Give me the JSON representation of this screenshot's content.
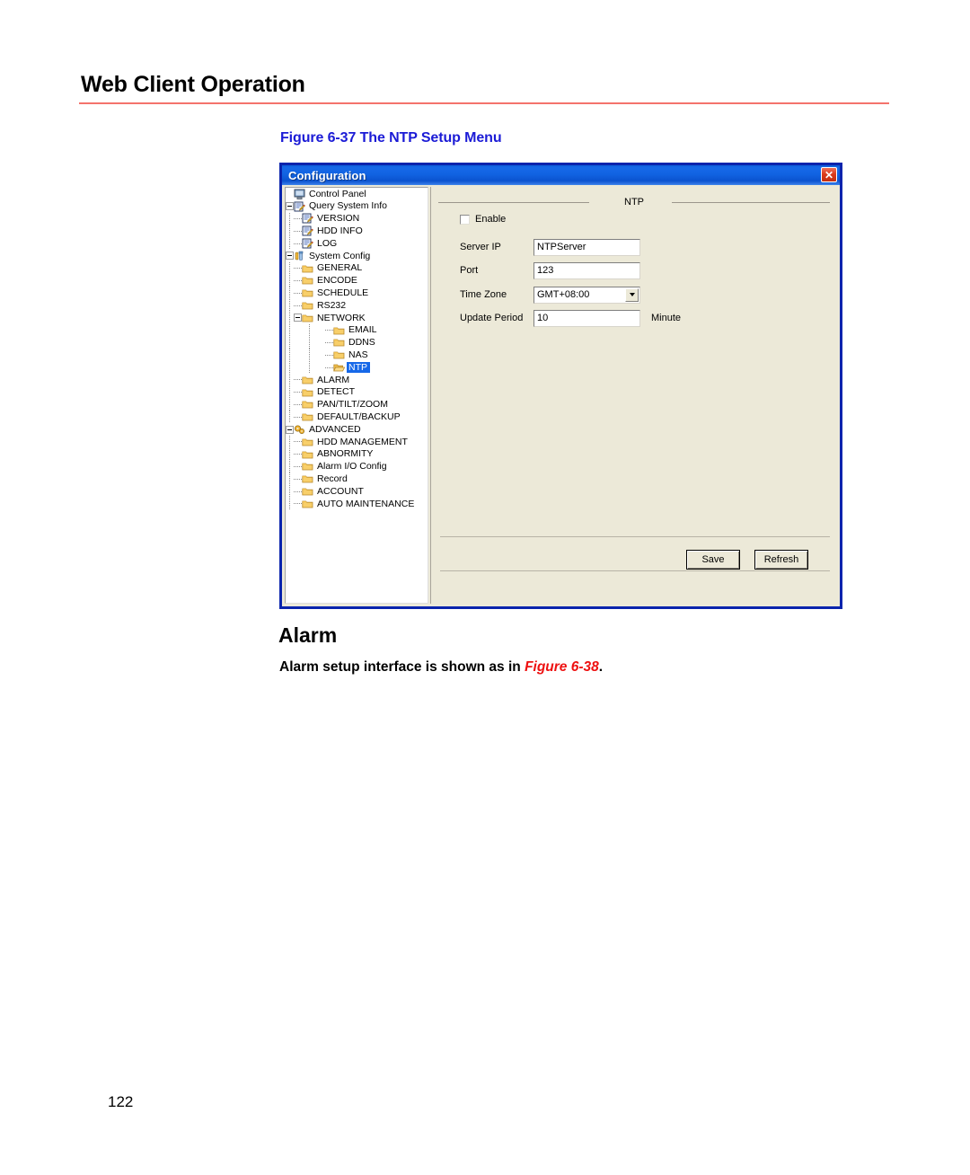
{
  "page": {
    "header_title": "Web Client Operation",
    "figure_caption": "Figure 6-37 The NTP Setup Menu",
    "section_heading": "Alarm",
    "body_text_before": "Alarm setup interface is shown as in ",
    "body_figref": "Figure 6-38",
    "body_text_after": ".",
    "page_number": "122",
    "rule_color": "#f4736c",
    "caption_color": "#1b1bd6",
    "figref_color": "#ee1111"
  },
  "dialog": {
    "title": "Configuration",
    "close_glyph": "✕",
    "titlebar_color": "#1163e2",
    "border_color": "#0a24ad",
    "face_color": "#ece9d8"
  },
  "tree": {
    "items": [
      {
        "label": "Control Panel",
        "depth": 0,
        "icon": "monitor-icon",
        "expander": "none",
        "selected": false
      },
      {
        "label": "Query System Info",
        "depth": 0,
        "icon": "notepad-icon",
        "expander": "expanded",
        "selected": false
      },
      {
        "label": "VERSION",
        "depth": 1,
        "icon": "notepad-icon",
        "expander": "leaf",
        "selected": false
      },
      {
        "label": "HDD INFO",
        "depth": 1,
        "icon": "notepad-icon",
        "expander": "leaf",
        "selected": false
      },
      {
        "label": "LOG",
        "depth": 1,
        "icon": "notepad-icon",
        "expander": "leaf",
        "selected": false
      },
      {
        "label": "System Config",
        "depth": 0,
        "icon": "tools-icon",
        "expander": "expanded",
        "selected": false
      },
      {
        "label": "GENERAL",
        "depth": 1,
        "icon": "folder-icon",
        "expander": "leaf",
        "selected": false
      },
      {
        "label": "ENCODE",
        "depth": 1,
        "icon": "folder-icon",
        "expander": "leaf",
        "selected": false
      },
      {
        "label": "SCHEDULE",
        "depth": 1,
        "icon": "folder-icon",
        "expander": "leaf",
        "selected": false
      },
      {
        "label": "RS232",
        "depth": 1,
        "icon": "folder-icon",
        "expander": "leaf",
        "selected": false
      },
      {
        "label": "NETWORK",
        "depth": 1,
        "icon": "folder-icon",
        "expander": "expanded",
        "selected": false
      },
      {
        "label": "EMAIL",
        "depth": 2,
        "icon": "folder-icon",
        "expander": "leaf",
        "selected": false
      },
      {
        "label": "DDNS",
        "depth": 2,
        "icon": "folder-icon",
        "expander": "leaf",
        "selected": false
      },
      {
        "label": "NAS",
        "depth": 2,
        "icon": "folder-icon",
        "expander": "leaf",
        "selected": false
      },
      {
        "label": "NTP",
        "depth": 2,
        "icon": "folder-open-icon",
        "expander": "leaf",
        "selected": true
      },
      {
        "label": "ALARM",
        "depth": 1,
        "icon": "folder-icon",
        "expander": "leaf",
        "selected": false
      },
      {
        "label": "DETECT",
        "depth": 1,
        "icon": "folder-icon",
        "expander": "leaf",
        "selected": false
      },
      {
        "label": "PAN/TILT/ZOOM",
        "depth": 1,
        "icon": "folder-icon",
        "expander": "leaf",
        "selected": false
      },
      {
        "label": "DEFAULT/BACKUP",
        "depth": 1,
        "icon": "folder-icon",
        "expander": "leaf",
        "selected": false
      },
      {
        "label": "ADVANCED",
        "depth": 0,
        "icon": "gears-icon",
        "expander": "expanded",
        "selected": false
      },
      {
        "label": "HDD MANAGEMENT",
        "depth": 1,
        "icon": "folder-icon",
        "expander": "leaf",
        "selected": false
      },
      {
        "label": "ABNORMITY",
        "depth": 1,
        "icon": "folder-icon",
        "expander": "leaf",
        "selected": false
      },
      {
        "label": "Alarm I/O Config",
        "depth": 1,
        "icon": "folder-icon",
        "expander": "leaf",
        "selected": false
      },
      {
        "label": "Record",
        "depth": 1,
        "icon": "folder-icon",
        "expander": "leaf",
        "selected": false
      },
      {
        "label": "ACCOUNT",
        "depth": 1,
        "icon": "folder-icon",
        "expander": "leaf",
        "selected": false
      },
      {
        "label": "AUTO MAINTENANCE",
        "depth": 1,
        "icon": "folder-icon",
        "expander": "leaf",
        "selected": false
      }
    ]
  },
  "form": {
    "group_title": "NTP",
    "enable_label": "Enable",
    "enable_checked": false,
    "server_ip_label": "Server IP",
    "server_ip_value": "NTPServer",
    "port_label": "Port",
    "port_value": "123",
    "time_zone_label": "Time Zone",
    "time_zone_value": "GMT+08:00",
    "update_period_label": "Update Period",
    "update_period_value": "10",
    "update_period_unit": "Minute"
  },
  "buttons": {
    "save_label": "Save",
    "refresh_label": "Refresh"
  }
}
